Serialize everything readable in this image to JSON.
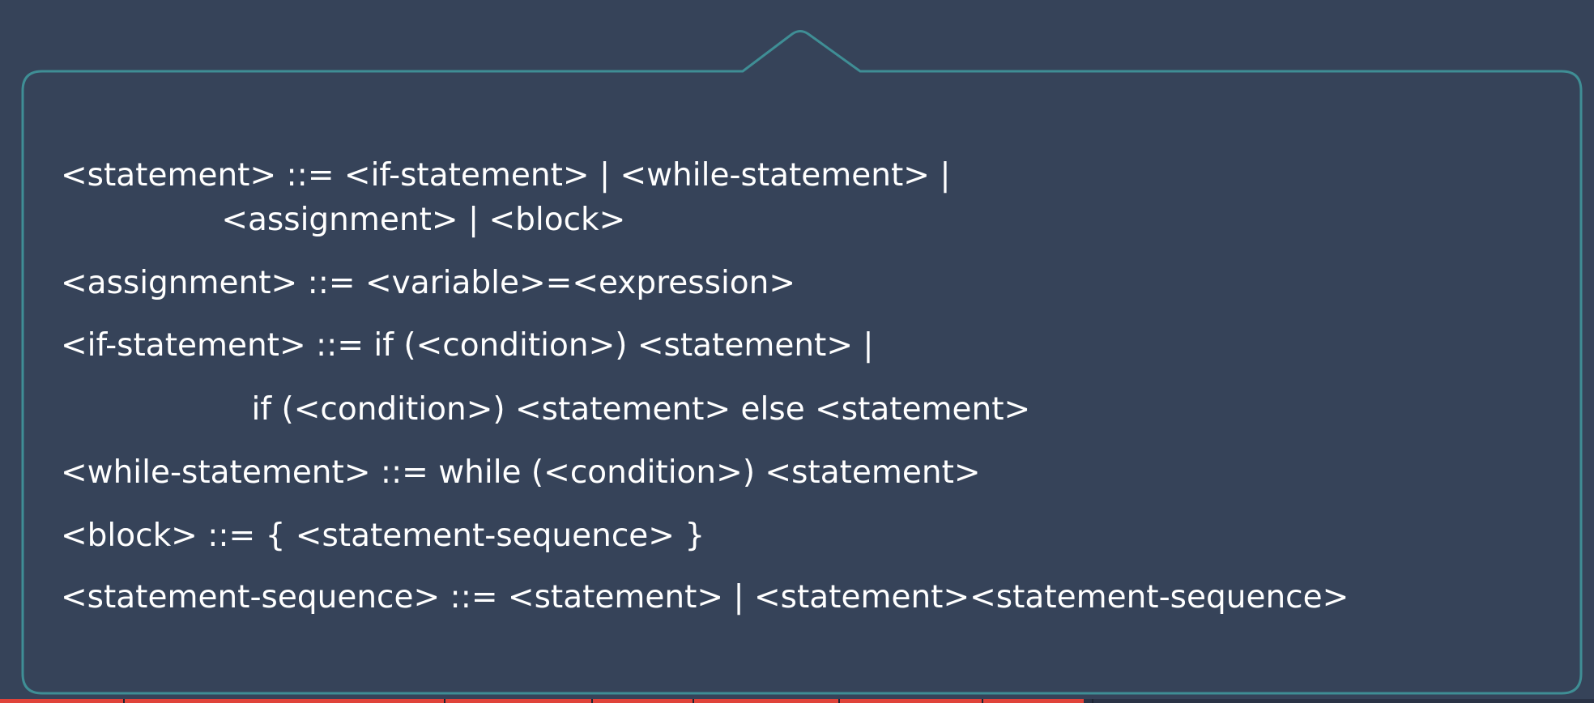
{
  "grammar": {
    "lines": [
      "<statement> ::= <if-statement> | <while-statement> |",
      "                <assignment> | <block>",
      "<assignment> ::= <variable>=<expression>",
      "<if-statement> ::= if (<condition>) <statement> |",
      "                   if (<condition>) <statement> else <statement>",
      "<while-statement> ::= while (<condition>) <statement>",
      "<block> ::= { <statement-sequence> }",
      "<statement-sequence> ::= <statement> | <statement><statement-sequence>"
    ]
  },
  "colors": {
    "background": "#364359",
    "frame_border": "#3f8e95",
    "text": "#ffffff",
    "progress_played": "#e0433a"
  },
  "video_progress": {
    "played_fraction": 0.68
  }
}
